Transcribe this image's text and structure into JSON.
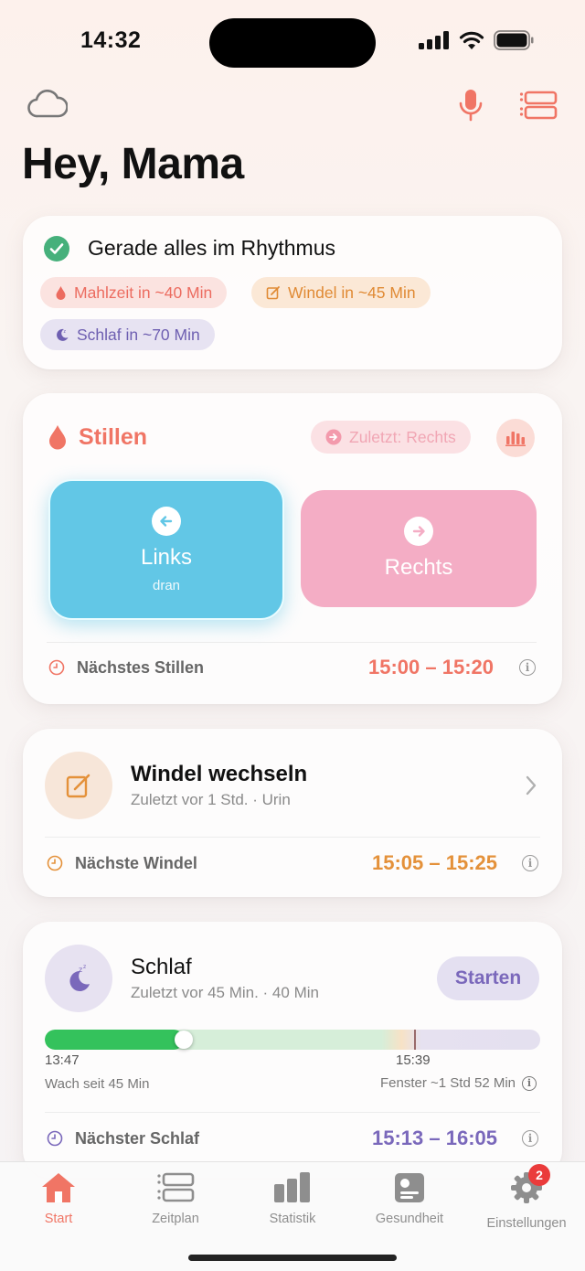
{
  "status_bar": {
    "time": "14:32"
  },
  "greeting": "Hey, Mama",
  "rhythm_card": {
    "title": "Gerade alles im Rhythmus",
    "chips": [
      {
        "label": "Mahlzeit in ~40 Min",
        "icon": "drop-icon"
      },
      {
        "label": "Windel in ~45 Min",
        "icon": "edit-icon"
      },
      {
        "label": "Schlaf in ~70 Min",
        "icon": "moon-icon"
      }
    ]
  },
  "stillen_card": {
    "title": "Stillen",
    "last_label": "Zuletzt: Rechts",
    "left": {
      "label": "Links",
      "sub": "dran"
    },
    "right": {
      "label": "Rechts"
    },
    "next_label": "Nächstes Stillen",
    "next_time": "15:00 – 15:20"
  },
  "windel_card": {
    "title": "Windel wechseln",
    "subtitle": "Zuletzt vor 1 Std. · Urin",
    "next_label": "Nächste Windel",
    "next_time": "15:05 – 15:25"
  },
  "schlaf_card": {
    "title": "Schlaf",
    "subtitle": "Zuletzt vor 45 Min. · 40 Min",
    "start_label": "Starten",
    "timeline_start": "13:47",
    "timeline_marker": "15:39",
    "awake_text": "Wach seit 45 Min",
    "window_text": "Fenster ~1 Std 52 Min",
    "progress_fraction": 0.28,
    "next_label": "Nächster Schlaf",
    "next_time": "15:13 – 16:05"
  },
  "tabbar": {
    "tabs": [
      {
        "label": "Start",
        "icon": "home-icon",
        "active": true
      },
      {
        "label": "Zeitplan",
        "icon": "schedule-icon",
        "active": false
      },
      {
        "label": "Statistik",
        "icon": "chart-icon",
        "active": false
      },
      {
        "label": "Gesundheit",
        "icon": "health-icon",
        "active": false
      },
      {
        "label": "Einstellungen",
        "icon": "gear-icon",
        "active": false,
        "badge": "2"
      }
    ]
  },
  "colors": {
    "accent_red": "#f07565",
    "stillen_blue": "#5fc6e4",
    "stillen_pink": "#f3a9c3",
    "windel_orange": "#e4913a",
    "schlaf_purple": "#7a68bb",
    "progress_green": "#34c25c"
  }
}
